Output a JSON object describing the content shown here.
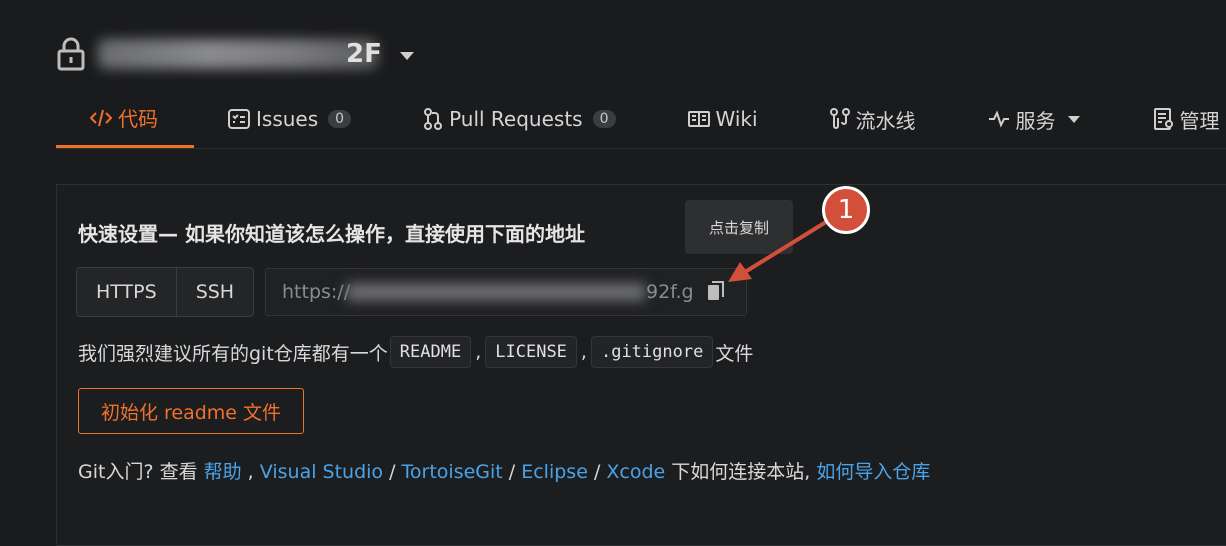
{
  "repo": {
    "name_visible": "2F"
  },
  "tabs": [
    {
      "icon": "code-icon",
      "label": "代码",
      "active": true
    },
    {
      "icon": "issues-icon",
      "label": "Issues",
      "badge": "0"
    },
    {
      "icon": "pull-request-icon",
      "label": "Pull Requests",
      "badge": "0"
    },
    {
      "icon": "wiki-icon",
      "label": "Wiki"
    },
    {
      "icon": "pipeline-icon",
      "label": "流水线"
    },
    {
      "icon": "pulse-icon",
      "label": "服务"
    },
    {
      "icon": "manage-icon",
      "label": "管理"
    }
  ],
  "quick_setup": {
    "title": "快速设置— 如果你知道该怎么操作，直接使用下面的地址",
    "protocols": [
      "HTTPS",
      "SSH"
    ],
    "url_start": "https://",
    "url_end": "92f.g",
    "tooltip": "点击复制"
  },
  "annotation": {
    "number": "1",
    "color": "#d2503a"
  },
  "readme": {
    "prefix": "我们强烈建议所有的git仓库都有一个",
    "files": [
      "README",
      "LICENSE",
      ".gitignore"
    ],
    "separator": ",",
    "suffix": "文件"
  },
  "init_button": "初始化 readme 文件",
  "help": {
    "prefix": "Git入门?  查看 ",
    "links": [
      "帮助",
      "Visual Studio",
      "TortoiseGit",
      "Eclipse",
      "Xcode"
    ],
    "middle": " 下如何连接本站, ",
    "import_link": "如何导入仓库"
  },
  "colors": {
    "accent": "#f0712c",
    "link": "#4aa3e8",
    "background": "#1a1b1d"
  }
}
